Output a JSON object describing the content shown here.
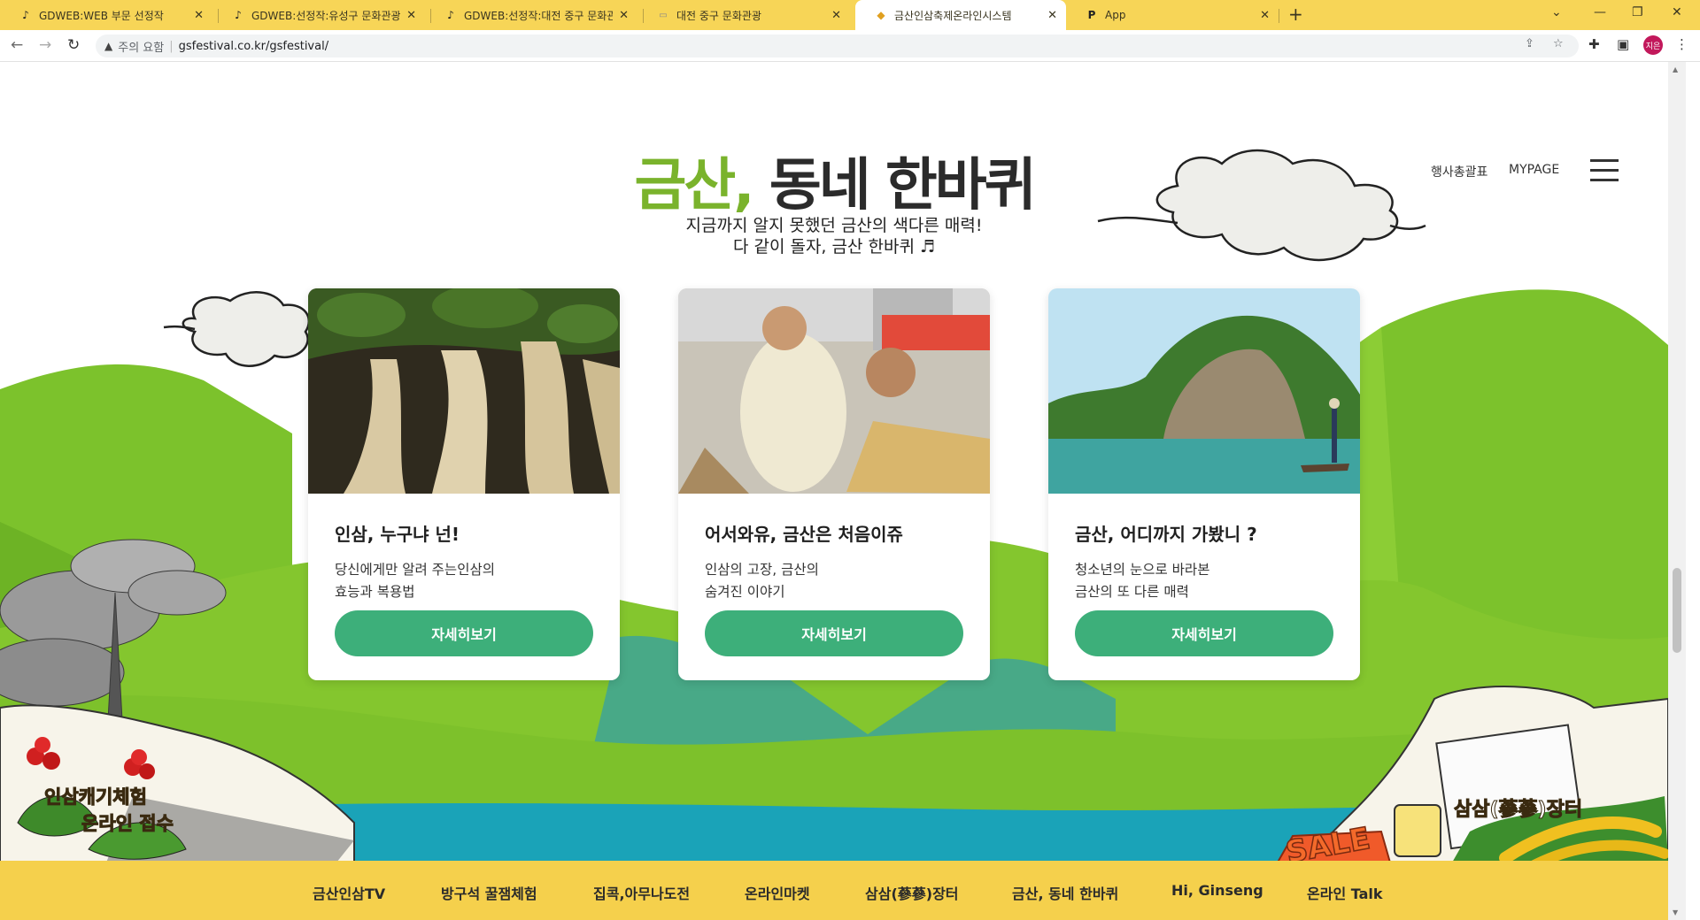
{
  "browser": {
    "tabs": [
      {
        "title": "GDWEB:WEB 부문 선정작",
        "icon": "tiktok-icon",
        "active": false
      },
      {
        "title": "GDWEB:선정작:유성구 문화관광",
        "icon": "tiktok-icon",
        "active": false
      },
      {
        "title": "GDWEB:선정작:대전 중구 문화관광",
        "icon": "tiktok-icon",
        "active": false
      },
      {
        "title": "대전 중구 문화관광",
        "icon": "site-icon",
        "active": false
      },
      {
        "title": "금산인삼축제온라인시스템",
        "icon": "ginseng-site-icon",
        "active": true
      },
      {
        "title": "App",
        "icon": "p-app-icon",
        "active": false
      }
    ],
    "address": {
      "warning": "주의 요함",
      "url": "gsfestival.co.kr/gsfestival/"
    },
    "profile_initials": "지은"
  },
  "header": {
    "title_green": "금산,",
    "title_dark": " 동네 한바퀴",
    "subtitle_line1": "지금까지 알지 못했던 금산의 색다른 매력!",
    "subtitle_line2": "다 같이 돌자, 금산 한바퀴 ♬",
    "links": {
      "schedule": "행사총괄표",
      "mypage": "MYPAGE"
    }
  },
  "cards": [
    {
      "title": "인삼, 누구냐 넌!",
      "desc_line1": "당신에게만 알려 주는인삼의",
      "desc_line2": "효능과 복용법",
      "button": "자세히보기",
      "photo": "ginseng-roots-photo"
    },
    {
      "title": "어서와유, 금산은 처음이쥬",
      "desc_line1": "인삼의 고장, 금산의",
      "desc_line2": "숨겨진 이야기",
      "button": "자세히보기",
      "photo": "festival-dancers-photo"
    },
    {
      "title": "금산, 어디까지 가봤니 ?",
      "desc_line1": "청소년의 눈으로 바라본",
      "desc_line2": "금산의 또 다른 매력",
      "button": "자세히보기",
      "photo": "river-cliff-photo"
    }
  ],
  "banners": {
    "left_line1": "인삼캐기체험",
    "left_line2": "온라인 접수",
    "right": "삼삼(蔘蔘)장터",
    "sale": "SALE"
  },
  "footer_nav": [
    "금산인삼TV",
    "방구석 꿀잼체험",
    "집콕,아무나도전",
    "온라인마켓",
    "삼삼(蔘蔘)장터",
    "금산, 동네 한바퀴",
    "Hi, Ginseng",
    "온라인 Talk"
  ],
  "colors": {
    "tab_bar": "#f7d557",
    "green_accent": "#7ab32c",
    "button_green": "#3daf7a",
    "footer_yellow": "#f5d04c",
    "mountain_green": "#7cc22c",
    "river_blue": "#1aa3b8"
  }
}
